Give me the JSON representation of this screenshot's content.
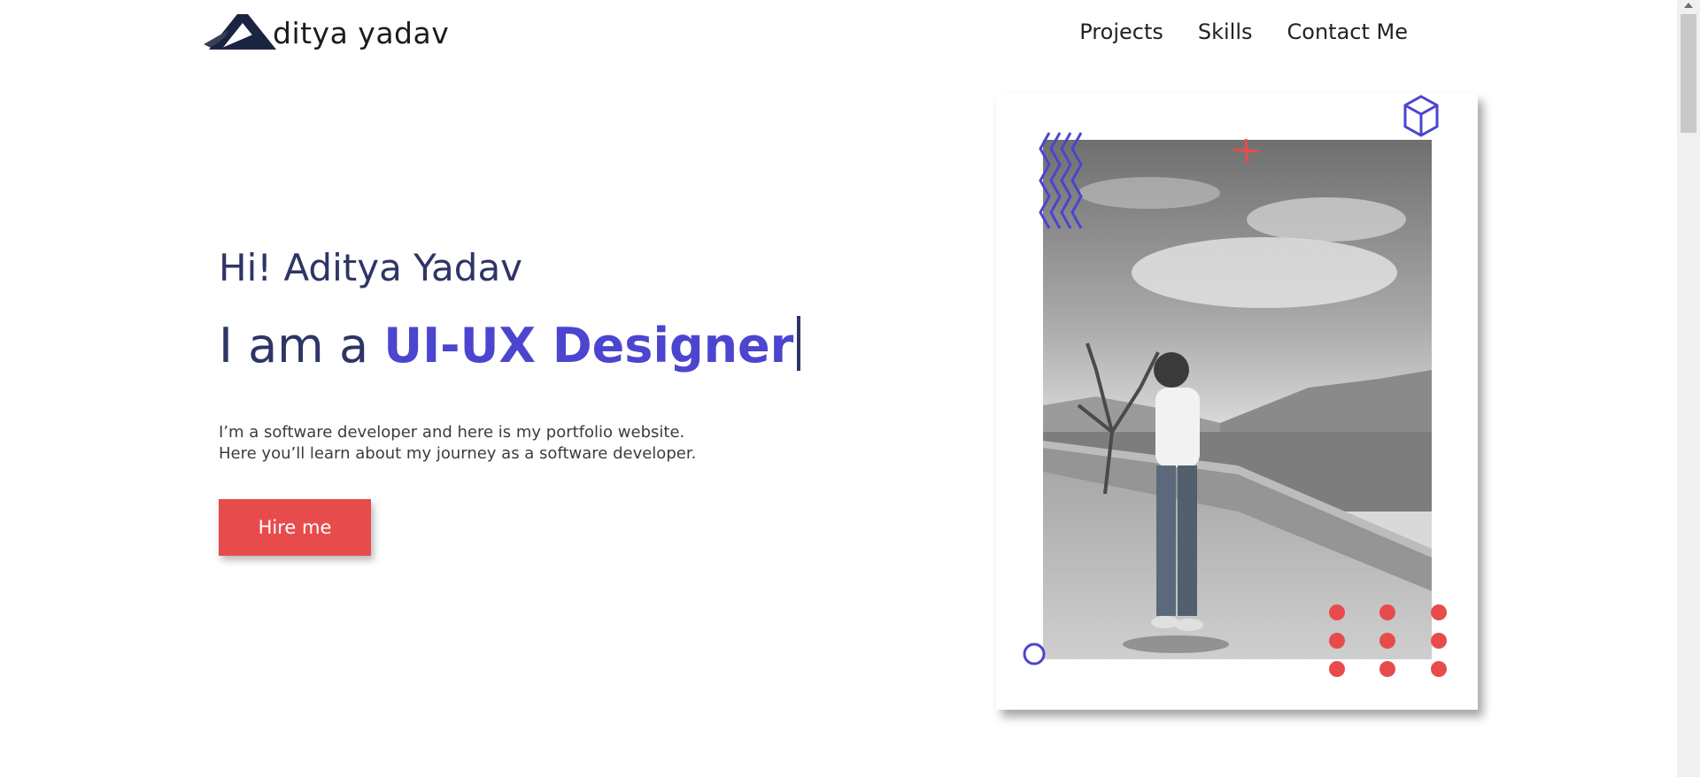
{
  "header": {
    "logo_text": "ditya yadav",
    "logo_icon": "stylized-a-mountain-logo",
    "nav": [
      {
        "label": "Projects"
      },
      {
        "label": "Skills"
      },
      {
        "label": "Contact Me"
      }
    ]
  },
  "hero": {
    "greeting": "Hi! Aditya Yadav",
    "role_prefix": "I am a ",
    "role": "UI-UX Designer",
    "bio_line1": "I’m a software developer and here is my portfolio website.",
    "bio_line2": "Here you’ll learn about my journey as a software developer.",
    "cta_label": "Hire me"
  },
  "photo": {
    "alt": "Portrait photo of Aditya Yadav standing on a hilltop",
    "style": "black-and-white"
  },
  "colors": {
    "accent_purple": "#4b45cf",
    "accent_red": "#e84b4b",
    "text_navy": "#2e3566"
  }
}
